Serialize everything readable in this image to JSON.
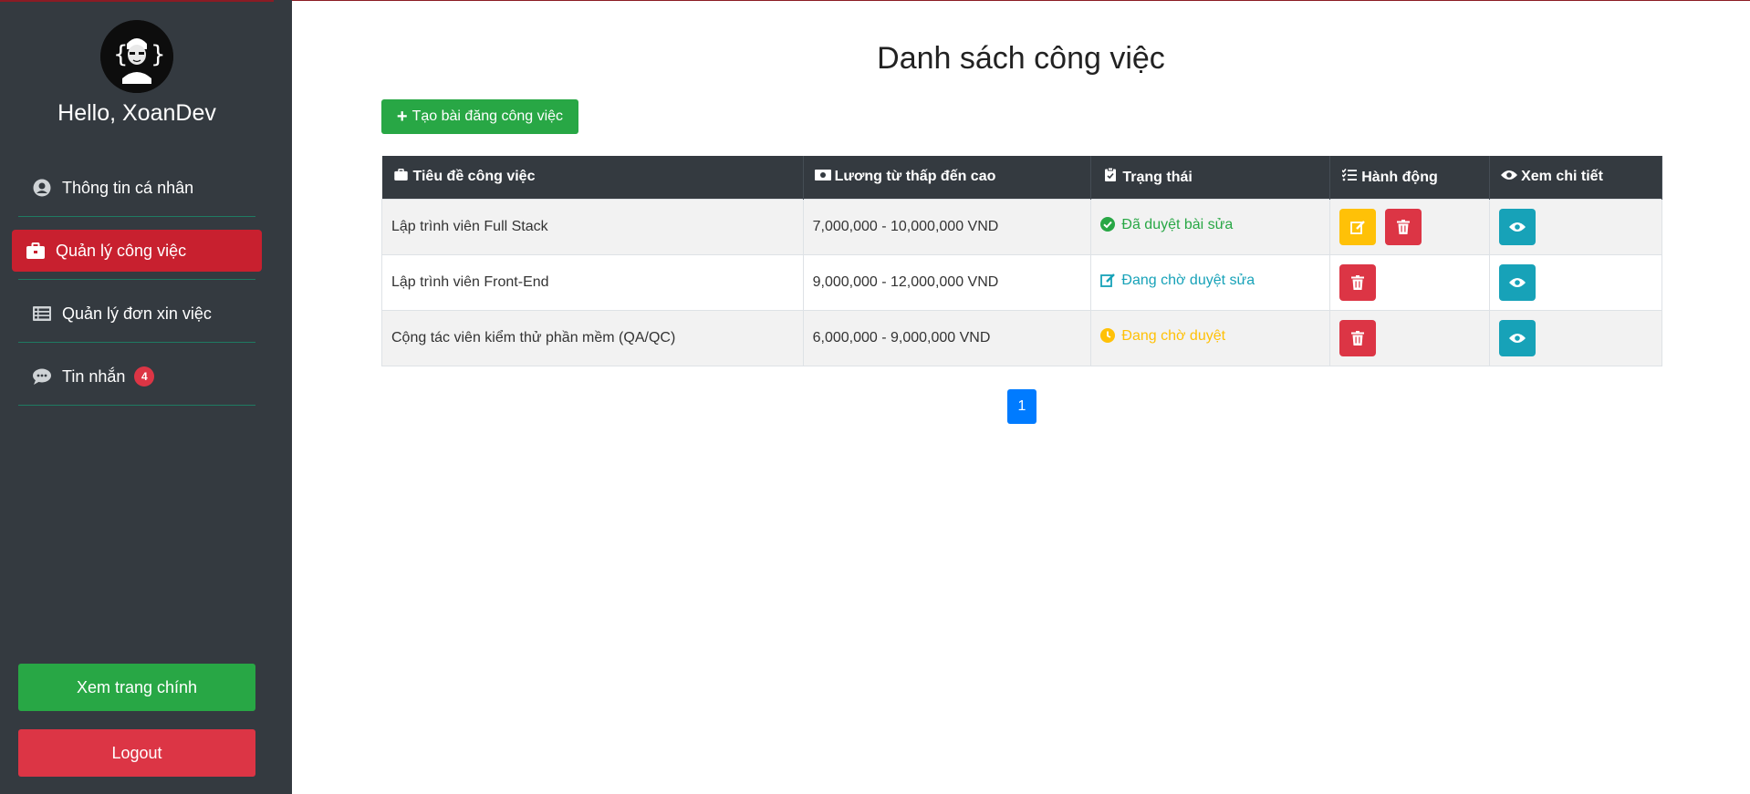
{
  "sidebar": {
    "greeting": "Hello, XoanDev",
    "avatar_icon": "developer-avatar-icon",
    "items": [
      {
        "label": "Thông tin cá nhân",
        "icon": "user-circle-icon"
      },
      {
        "label": "Quản lý công việc",
        "icon": "briefcase-icon",
        "active": true
      },
      {
        "label": "Quản lý đơn xin việc",
        "icon": "list-icon"
      },
      {
        "label": "Tin nhắn",
        "icon": "chat-icon",
        "badge": "4"
      }
    ],
    "home_button": "Xem trang chính",
    "logout_button": "Logout"
  },
  "main": {
    "title": "Danh sách công việc",
    "create_button": "Tạo bài đăng công việc",
    "table": {
      "headers": [
        "Tiêu đề công việc",
        "Lương từ thấp đến cao",
        "Trạng thái",
        "Hành động",
        "Xem chi tiết"
      ],
      "rows": [
        {
          "title": "Lập trình viên Full Stack",
          "salary": "7,000,000 - 10,000,000 VND",
          "status": "Đã duyệt bài sửa",
          "status_type": "approved"
        },
        {
          "title": "Lập trình viên Front-End",
          "salary": "9,000,000 - 12,000,000 VND",
          "status": "Đang chờ duyệt sửa",
          "status_type": "edit-pending"
        },
        {
          "title": "Cộng tác viên kiểm thử phần mềm (QA/QC)",
          "salary": "6,000,000 - 9,000,000 VND",
          "status": "Đang chờ duyệt",
          "status_type": "pending"
        }
      ]
    },
    "pagination": {
      "current": "1"
    }
  },
  "colors": {
    "sidebar_bg": "#343a40",
    "active": "#c8202f",
    "success": "#28a745",
    "danger": "#dc3545",
    "warning": "#ffc107",
    "info": "#17a2b8",
    "primary": "#007bff"
  }
}
